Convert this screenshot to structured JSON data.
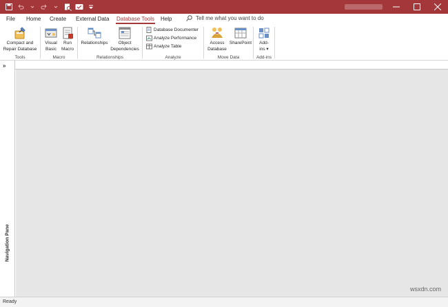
{
  "titlebar": {
    "window_controls": [
      "minimize-icon",
      "maximize-icon",
      "close-icon"
    ]
  },
  "tabs": [
    "File",
    "Home",
    "Create",
    "External Data",
    "Database Tools",
    "Help"
  ],
  "active_tab": "Database Tools",
  "tell_me": "Tell me what you want to do",
  "ribbon": {
    "tools": {
      "label": "Tools",
      "compact_line1": "Compact and",
      "compact_line2": "Repair Database"
    },
    "macro": {
      "label": "Macro",
      "vb_line1": "Visual",
      "vb_line2": "Basic",
      "run_line1": "Run",
      "run_line2": "Macro"
    },
    "relationships": {
      "label": "Relationships",
      "rel": "Relationships",
      "obj_line1": "Object",
      "obj_line2": "Dependencies"
    },
    "analyze": {
      "label": "Analyze",
      "documenter": "Database Documenter",
      "performance": "Analyze Performance",
      "table": "Analyze Table"
    },
    "move_data": {
      "label": "Move Data",
      "access_line1": "Access",
      "access_line2": "Database",
      "sharepoint": "SharePoint"
    },
    "addins": {
      "label": "Add-ins",
      "btn_line1": "Add-",
      "btn_line2": "ins ▾"
    }
  },
  "nav": {
    "toggle": "»",
    "label": "Navigation Pane"
  },
  "status": {
    "text": "Ready"
  },
  "watermark": "wsxdn.com",
  "colors": {
    "accent": "#a4373a",
    "workspace": "#e6e6e6"
  }
}
